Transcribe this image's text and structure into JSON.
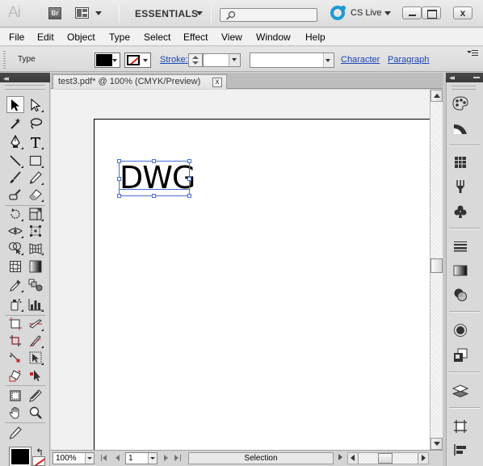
{
  "app": {
    "logo_text": "Ai",
    "bridge_badge": "Br",
    "workspace_label": "ESSENTIALS",
    "search_placeholder": "",
    "cs_live_label": "CS Live",
    "close_glyph": "x"
  },
  "menu": {
    "items": [
      "File",
      "Edit",
      "Object",
      "Type",
      "Select",
      "Effect",
      "View",
      "Window",
      "Help"
    ]
  },
  "control_bar": {
    "mode_label": "Type",
    "fill_color": "#000000",
    "stroke_label": "Stroke:",
    "stroke_value": "",
    "font_value": "",
    "character_link": "Character",
    "paragraph_link": "Paragraph"
  },
  "document": {
    "tab_title": "test3.pdf* @ 100% (CMYK/Preview)",
    "tab_close": "x",
    "artboard_text": "DWG"
  },
  "status_bar": {
    "zoom": "100%",
    "page": "1",
    "status_text": "Selection"
  },
  "toolbox": {
    "tools": [
      "selection-tool",
      "direct-selection-tool",
      "magic-wand-tool",
      "lasso-tool",
      "pen-tool",
      "type-tool",
      "line-segment-tool",
      "rectangle-tool",
      "paintbrush-tool",
      "pencil-tool",
      "blob-brush-tool",
      "eraser-tool",
      "rotate-tool",
      "scale-tool",
      "width-tool",
      "free-transform-tool",
      "shape-builder-tool",
      "perspective-grid-tool",
      "mesh-tool",
      "gradient-tool",
      "eyedropper-tool",
      "blend-tool",
      "symbol-sprayer-tool",
      "column-graph-tool",
      "artboard-tool",
      "slice-tool",
      "crop-area-tool",
      "knife-tool",
      "anchor-point-tool",
      "live-paint-selection-tool",
      "live-paint-bucket-tool",
      "perspective-selection-tool",
      "crop-tool",
      "measure-tool",
      "hand-tool",
      "zoom-tool",
      "pencil-small-tool"
    ],
    "fill_color": "#000000",
    "stroke_color": "#ffffff",
    "none_color": "#e01e1e"
  },
  "dock": {
    "panels": [
      "color-panel",
      "color-guide-panel",
      "swatches-panel",
      "brushes-panel",
      "symbols-panel",
      "stroke-panel",
      "gradient-panel",
      "transparency-panel",
      "appearance-panel",
      "graphic-styles-panel",
      "layers-panel",
      "artboards-panel",
      "align-panel"
    ]
  },
  "colors": {
    "link": "#1b45b8",
    "selection_box": "#4a6ed8",
    "cs_live_accent": "#1d9ad6"
  }
}
